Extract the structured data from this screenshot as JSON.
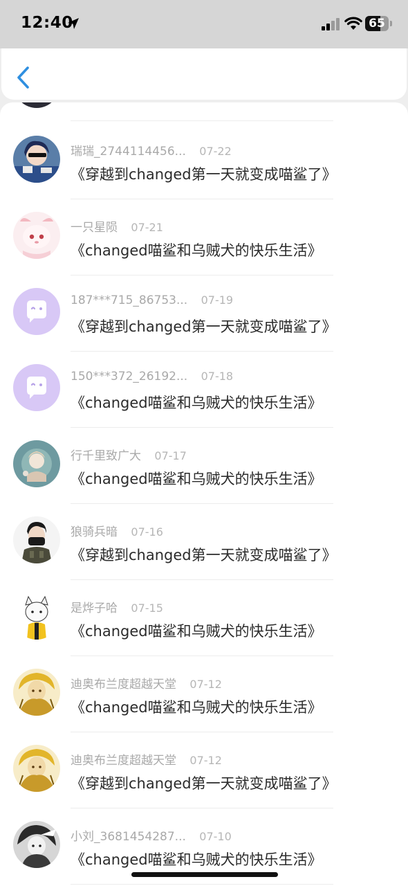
{
  "status_bar": {
    "time": "12:40",
    "battery": "65",
    "battery_level": 0.65
  },
  "header": {
    "back_icon": "chevron-left-icon",
    "accent_color": "#2f8fe0"
  },
  "items": [
    {
      "username": "瑞瑞_2744114456...",
      "date": "07-22",
      "title": "《穿越到changed第一天就变成喵鲨了》",
      "avatar": "anime-blue-hair"
    },
    {
      "username": "一只星陨",
      "date": "07-21",
      "title": "《changed喵鲨和乌贼犬的快乐生活》",
      "avatar": "pink-furry"
    },
    {
      "username": "187***715_86753...",
      "date": "07-19",
      "title": "《穿越到changed第一天就变成喵鲨了》",
      "avatar": "default-purple"
    },
    {
      "username": "150***372_26192...",
      "date": "07-18",
      "title": "《changed喵鲨和乌贼犬的快乐生活》",
      "avatar": "default-purple"
    },
    {
      "username": "行千里致广大",
      "date": "07-17",
      "title": "《changed喵鲨和乌贼犬的快乐生活》",
      "avatar": "teal-illustration"
    },
    {
      "username": "狼骑兵暗",
      "date": "07-16",
      "title": "《穿越到changed第一天就变成喵鲨了》",
      "avatar": "masked-soldier"
    },
    {
      "username": "是烨子哈",
      "date": "07-15",
      "title": "《changed喵鲨和乌贼犬的快乐生活》",
      "avatar": "white-fox"
    },
    {
      "username": "迪奥布兰度超越天堂",
      "date": "07-12",
      "title": "《changed喵鲨和乌贼犬的快乐生活》",
      "avatar": "golden-manga"
    },
    {
      "username": "迪奥布兰度超越天堂",
      "date": "07-12",
      "title": "《穿越到changed第一天就变成喵鲨了》",
      "avatar": "golden-manga"
    },
    {
      "username": "小刘_3681454287...",
      "date": "07-10",
      "title": "《changed喵鲨和乌贼犬的快乐生活》",
      "avatar": "bw-manga"
    }
  ]
}
